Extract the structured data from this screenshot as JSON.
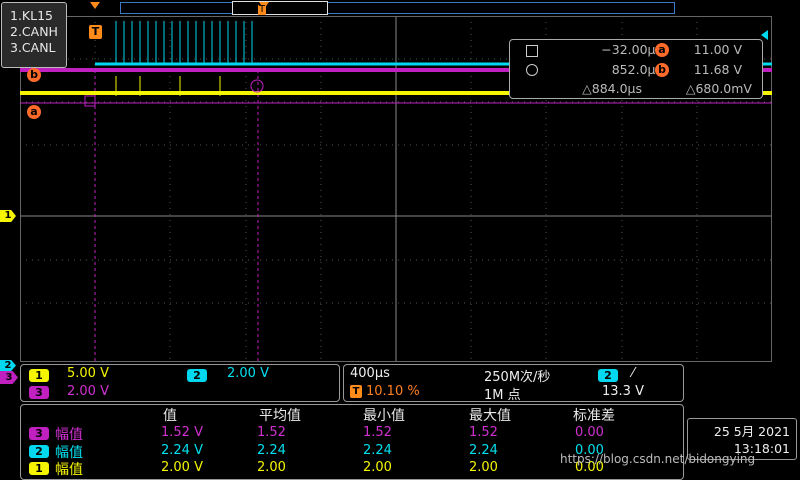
{
  "legend": [
    "1.KL15",
    "2.CANH",
    "3.CANL"
  ],
  "trigger_marker": "T",
  "cursor_labels": {
    "a": "a",
    "b": "b"
  },
  "cursor_readout": {
    "t_a": "−32.00µs",
    "t_b": "852.0µs",
    "v_a": "11.00 V",
    "v_b": "11.68 V",
    "dt": "△884.0µs",
    "dv": "△680.0mV"
  },
  "channels": {
    "ch1": {
      "num": "1",
      "scale": "5.00 V",
      "color": "#f5f500"
    },
    "ch2": {
      "num": "2",
      "scale": "2.00 V",
      "color": "#00d8f0"
    },
    "ch3": {
      "num": "3",
      "scale": "2.00 V",
      "color": "#c020c0"
    }
  },
  "timebase": {
    "scale": "400µs",
    "sample_rate": "250M次/秒",
    "trigger_pos": "10.10 %",
    "record_length": "1M 点",
    "trigger_channel": "2",
    "trigger_slope": "⁄",
    "trigger_level": "13.3 V"
  },
  "measurements": {
    "headers": [
      "值",
      "平均值",
      "最小值",
      "最大值",
      "标准差"
    ],
    "rows": [
      {
        "ch": "3",
        "name": "幅值",
        "values": [
          "1.52 V",
          "1.52",
          "1.52",
          "1.52",
          "0.00"
        ],
        "color": "#c020c0"
      },
      {
        "ch": "2",
        "name": "幅值",
        "values": [
          "2.24 V",
          "2.24",
          "2.24",
          "2.24",
          "0.00"
        ],
        "color": "#00d8f0"
      },
      {
        "ch": "1",
        "name": "幅值",
        "values": [
          "2.00 V",
          "2.00",
          "2.00",
          "2.00",
          "0.00"
        ],
        "color": "#f5f500"
      }
    ]
  },
  "datetime": {
    "date": "25 5月 2021",
    "time": "13:18:01"
  },
  "watermark": "https://blog.csdn.net/bidongying"
}
